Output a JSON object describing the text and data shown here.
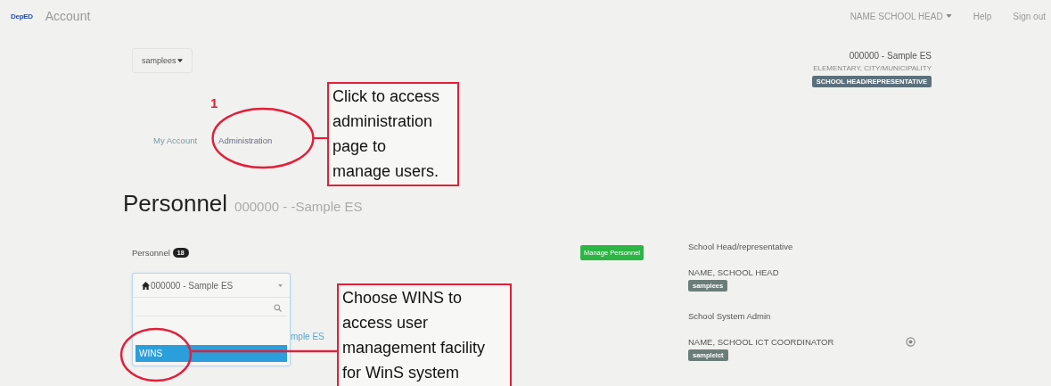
{
  "navbar": {
    "logo": "DepED",
    "title": "Account",
    "user_menu": "NAME SCHOOL HEAD",
    "links": [
      "Help",
      "Sign out"
    ]
  },
  "school_picker": {
    "label": "samplees"
  },
  "school_info": {
    "name": "000000 - Sample ES",
    "type": "ELEMENTARY, CITY/MUNICIPALITY",
    "role_badge": "SCHOOL HEAD/REPRESENTATIVE"
  },
  "tabs": [
    {
      "label": "My Account",
      "selected": false
    },
    {
      "label": "Administration",
      "selected": true
    }
  ],
  "heading": {
    "title": "Personnel",
    "subtitle": "000000 - -Sample ES"
  },
  "personnel": {
    "label": "Personnel",
    "count": "18",
    "manage_button": "Manage Personnel",
    "dropdown": {
      "value": "000000 - Sample ES",
      "expanded": true,
      "options": [
        {
          "label": "WINS",
          "selected": true
        }
      ]
    },
    "behind_text": "mple ES"
  },
  "roles": [
    {
      "title": "School Head/representative",
      "name": "NAME, SCHOOL HEAD",
      "badge": "samplees",
      "removable": false
    },
    {
      "title": "School System Admin",
      "name": "NAME, SCHOOL ICT COORDINATOR",
      "badge": "sampleict",
      "removable": true
    }
  ],
  "annotations": [
    {
      "number": "1",
      "text": "Click to access\nadministration\npage to\nmanage users."
    },
    {
      "text": "Choose WINS to\naccess user\nmanagement facility\nfor WinS system"
    }
  ]
}
